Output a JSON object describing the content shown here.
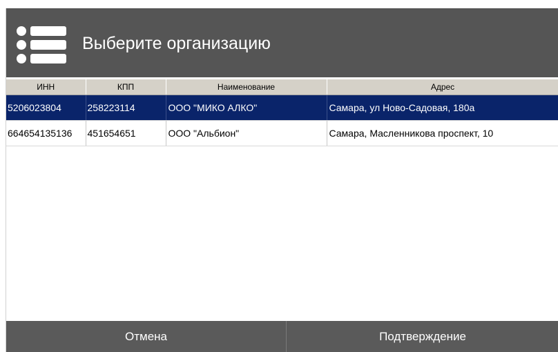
{
  "header": {
    "title": "Выберите организацию",
    "icon": "list-icon"
  },
  "table": {
    "columns": [
      "ИНН",
      "КПП",
      "Наименование",
      "Адрес"
    ],
    "rows": [
      {
        "inn": "5206023804",
        "kpp": "258223114",
        "name": "ООО \"МИКО АЛКО\"",
        "address": "Самара, ул Ново-Садовая, 180а",
        "selected": true
      },
      {
        "inn": "664654135136",
        "kpp": "451654651",
        "name": "ООО \"Альбион\"",
        "address": "Самара, Масленникова проспект, 10",
        "selected": false
      }
    ]
  },
  "footer": {
    "cancel_label": "Отмена",
    "confirm_label": "Подтверждение"
  },
  "colors": {
    "header_bg": "#555555",
    "selected_row": "#0a246a",
    "column_header_bg": "#d5d1c8",
    "button_bg": "#5a5a5a"
  }
}
